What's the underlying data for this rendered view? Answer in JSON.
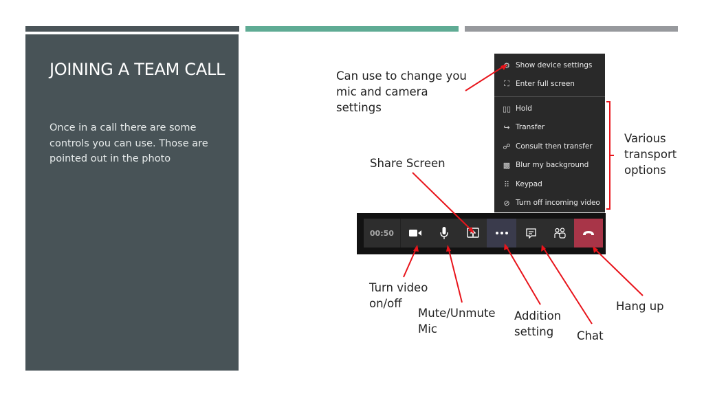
{
  "slide": {
    "title": "JOINING A TEAM CALL",
    "body": "Once in a call there are some controls you can use. Those are pointed out in the photo",
    "accent_bars": [
      "#4a5458",
      "#5fab94",
      "#97999d"
    ]
  },
  "menu": {
    "items": [
      {
        "icon": "gear-icon",
        "label": "Show device settings"
      },
      {
        "icon": "fullscreen-icon",
        "label": "Enter full screen"
      },
      {
        "icon": "hold-icon",
        "label": "Hold"
      },
      {
        "icon": "transfer-icon",
        "label": "Transfer"
      },
      {
        "icon": "consult-icon",
        "label": "Consult then transfer"
      },
      {
        "icon": "blur-icon",
        "label": "Blur my background"
      },
      {
        "icon": "keypad-icon",
        "label": "Keypad"
      },
      {
        "icon": "video-off-icon",
        "label": "Turn off incoming video"
      }
    ]
  },
  "toolbar": {
    "timer": "00:50",
    "buttons": [
      "camera",
      "microphone",
      "share-screen",
      "more-options",
      "chat",
      "participants",
      "hang-up"
    ],
    "hangup_color": "#a83548"
  },
  "annotations": {
    "device_settings": "Can use to change you mic and camera settings",
    "transport": "Various transport options",
    "share_screen": "Share Screen",
    "video": "Turn video on/off",
    "mute": "Mute/Unmute Mic",
    "addition": "Addition setting",
    "chat": "Chat",
    "hangup": "Hang up",
    "line_color": "#e8141b"
  }
}
